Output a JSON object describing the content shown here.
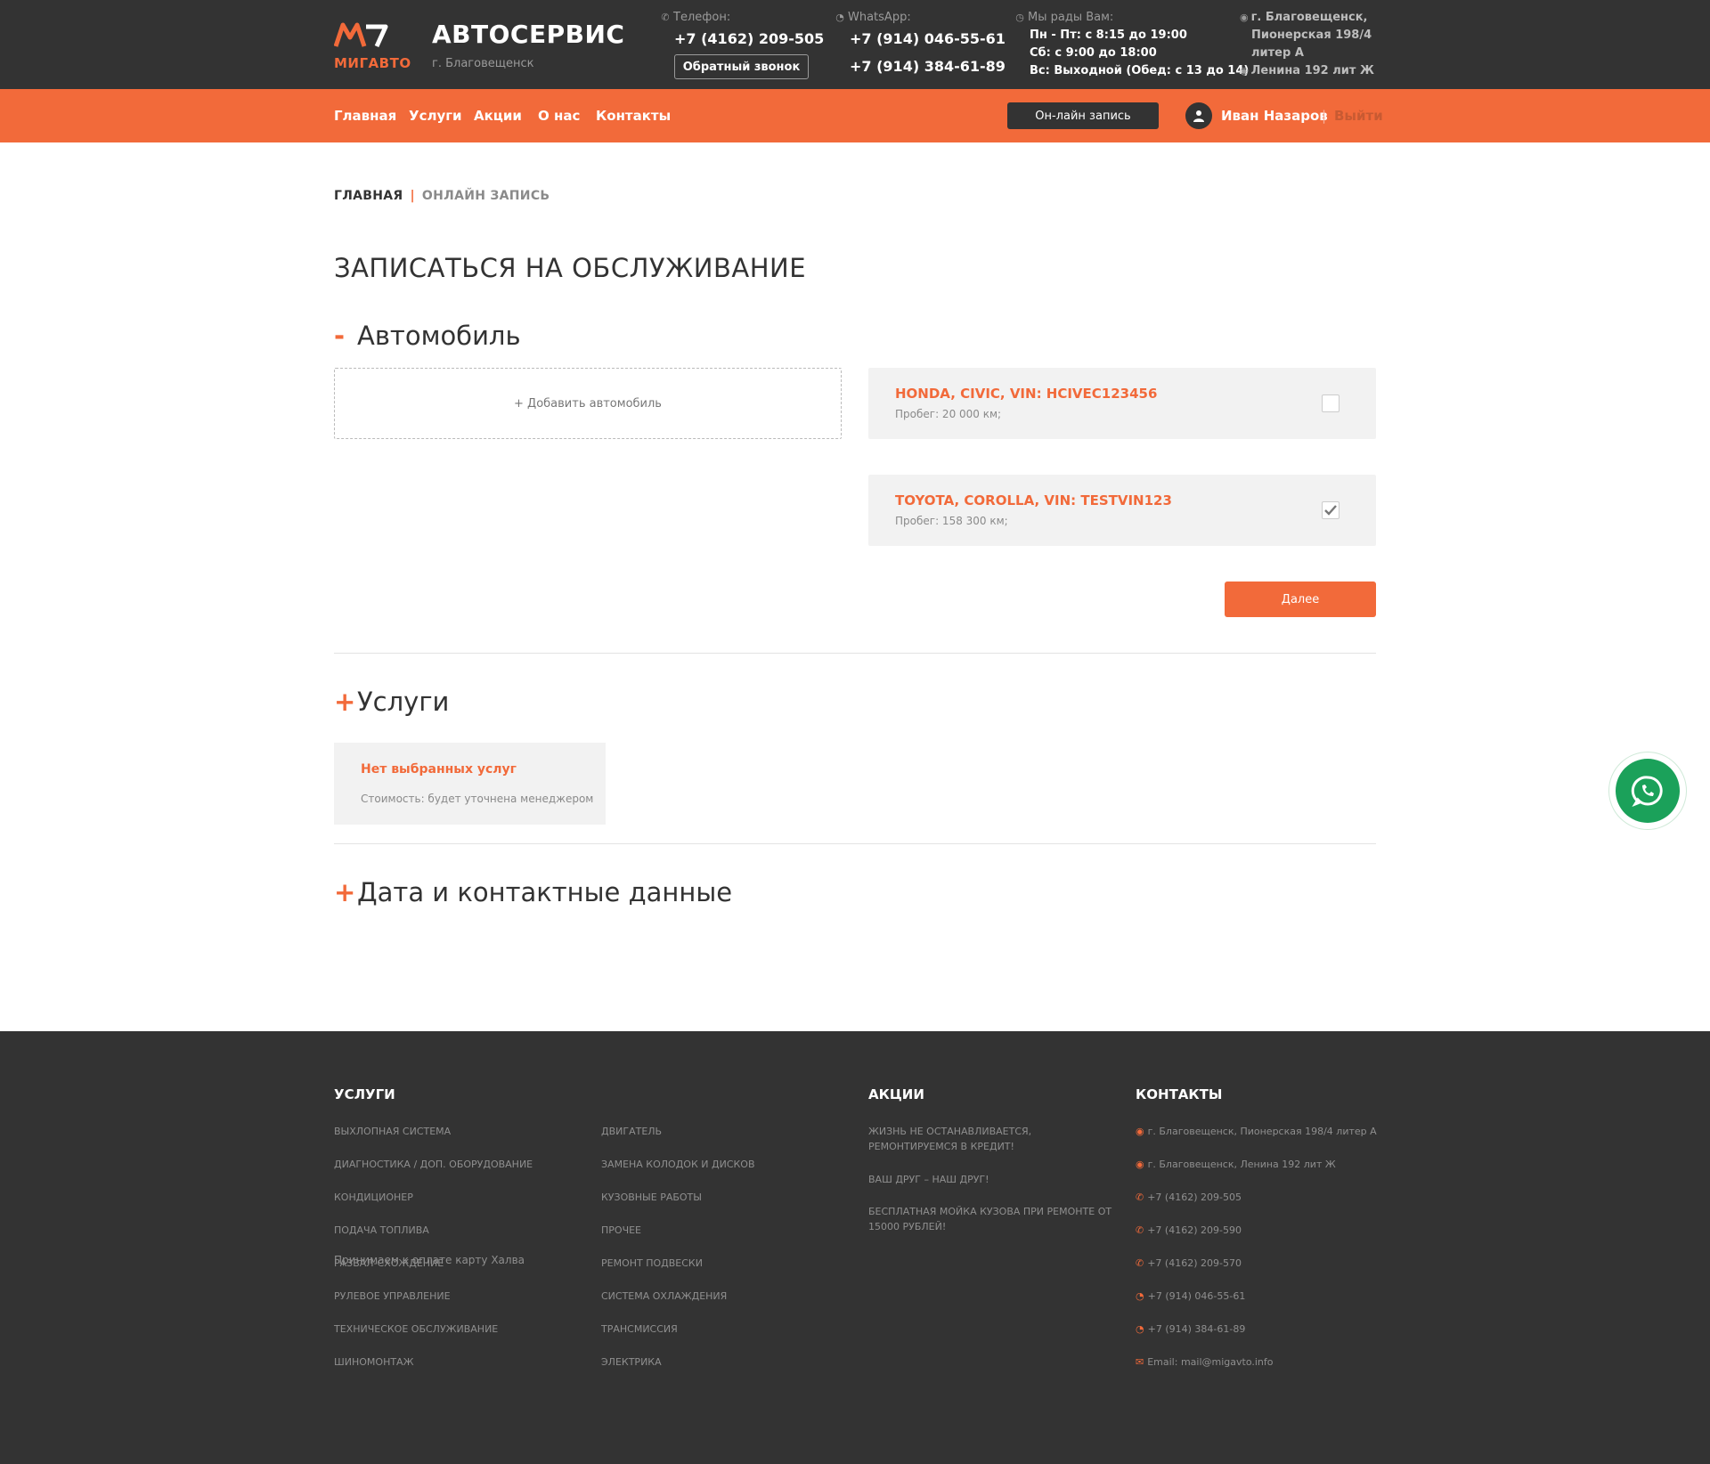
{
  "header": {
    "logo_text": "МИГАВТО",
    "title": "АВТОСЕРВИС",
    "city": "г. Благовещенск",
    "phone_label": "Телефон:",
    "phone": "+7 (4162) 209-505",
    "callback_label": "Обратный звонок",
    "whatsapp_label": "WhatsApp:",
    "whatsapp_1": "+7 (914) 046-55-61",
    "whatsapp_2": "+7 (914) 384-61-89",
    "hours_label": "Мы рады Вам:",
    "hours_1": "Пн - Пт: с 8:15 до 19:00",
    "hours_2": "Сб: с 9:00 до 18:00",
    "hours_3": "Вс: Выходной (Обед: с 13 до 14)",
    "address_1a": "г. Благовещенск,",
    "address_1b": "Пионерская 198/4",
    "address_1c": "литер А",
    "address_2": "Ленина 192 лит Ж"
  },
  "nav": {
    "items": [
      "Главная",
      "Услуги",
      "Акции",
      "О нас",
      "Контакты"
    ],
    "online_label": "Он-лайн запись",
    "user_name": "Иван Назаров",
    "separator": "|",
    "logout_label": "Выйти"
  },
  "breadcrumb": {
    "home": "ГЛАВНАЯ",
    "separator": "|",
    "current": "ОНЛАЙН ЗАПИСЬ"
  },
  "page_title": "ЗАПИСАТЬСЯ НА ОБСЛУЖИВАНИЕ",
  "car_section": {
    "sign": "-",
    "title": "Автомобиль",
    "add_label": "+ Добавить автомобиль",
    "cars": [
      {
        "name": "HONDA, CIVIC, VIN: HCIVEC123456",
        "mileage": "Пробег: 20 000 км;",
        "checked": false
      },
      {
        "name": "TOYOTA, COROLLA, VIN: TESTVIN123",
        "mileage": "Пробег: 158 300 км;",
        "checked": true
      }
    ],
    "next_label": "Далее"
  },
  "services_section": {
    "sign": "+",
    "title": "Услуги",
    "empty_title": "Нет выбранных услуг",
    "empty_note": "Стоимость: будет уточнена менеджером"
  },
  "date_section": {
    "sign": "+",
    "title": "Дата и контактные данные"
  },
  "footer": {
    "services_heading": "УСЛУГИ",
    "services_col1": [
      "ВЫХЛОПНАЯ СИСТЕМА",
      "ДИАГНОСТИКА / ДОП. ОБОРУДОВАНИЕ",
      "КОНДИЦИОНЕР",
      "ПОДАЧА ТОПЛИВА",
      "РАЗВАЛ-СХОЖДЕНИЕ",
      "РУЛЕВОЕ УПРАВЛЕНИЕ",
      "ТЕХНИЧЕСКОЕ ОБСЛУЖИВАНИЕ",
      "ШИНОМОНТАЖ"
    ],
    "services_col2": [
      "ДВИГАТЕЛЬ",
      "ЗАМЕНА КОЛОДОК И ДИСКОВ",
      "КУЗОВНЫЕ РАБОТЫ",
      "ПРОЧЕЕ",
      "РЕМОНТ ПОДВЕСКИ",
      "СИСТЕМА ОХЛАЖДЕНИЯ",
      "ТРАНСМИССИЯ",
      "ЭЛЕКТРИКА"
    ],
    "promo_heading": "АКЦИИ",
    "promo_1a": "ЖИЗНЬ НЕ ОСТАНАВЛИВАЕТСЯ,",
    "promo_1b": "РЕМОНТИРУЕМСЯ В КРЕДИТ!",
    "promo_2": "ВАШ ДРУГ – НАШ ДРУГ!",
    "promo_3a": "БЕСПЛАТНАЯ МОЙКА КУЗОВА ПРИ РЕМОНТЕ ОТ",
    "promo_3b": "15000 РУБЛЕЙ!",
    "contacts_heading": "КОНТАКТЫ",
    "contacts": [
      {
        "icon": "map-pin-icon",
        "text": "г. Благовещенск, Пионерская 198/4 литер А"
      },
      {
        "icon": "map-pin-icon",
        "text": "г. Благовещенск, Ленина 192 лит Ж"
      },
      {
        "icon": "phone-icon",
        "text": "+7 (4162) 209-505"
      },
      {
        "icon": "phone-icon",
        "text": "+7 (4162) 209-590"
      },
      {
        "icon": "phone-icon",
        "text": "+7 (4162) 209-570"
      },
      {
        "icon": "whatsapp-icon",
        "text": "+7 (914) 046-55-61"
      },
      {
        "icon": "whatsapp-icon",
        "text": "+7 (914) 384-61-89"
      },
      {
        "icon": "mail-icon",
        "text": "Email: mail@migavto.info"
      }
    ],
    "payment_note": "Принимаем к оплате карту Халва"
  },
  "colors": {
    "accent": "#f26a3a",
    "dark": "#333333",
    "whatsapp": "#1ba15a"
  }
}
